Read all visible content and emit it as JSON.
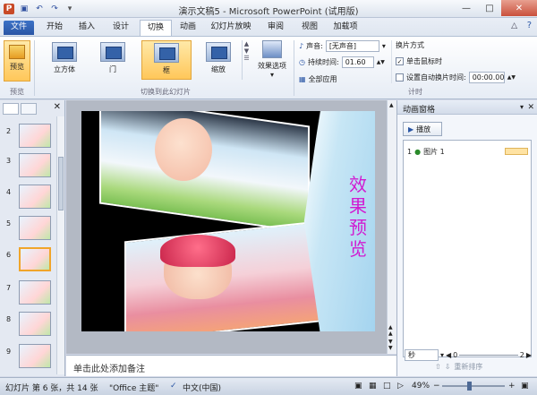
{
  "window": {
    "title": "演示文稿5 - Microsoft PowerPoint (试用版)",
    "buttons": [
      "minimize",
      "maximize",
      "close"
    ]
  },
  "quick_access": [
    "save-icon",
    "undo-icon",
    "redo-icon",
    "customize-icon"
  ],
  "tabs": [
    {
      "label": "文件",
      "active": false
    },
    {
      "label": "开始",
      "active": false
    },
    {
      "label": "插入",
      "active": false
    },
    {
      "label": "设计",
      "active": false
    },
    {
      "label": "切换",
      "active": true
    },
    {
      "label": "动画",
      "active": false
    },
    {
      "label": "幻灯片放映",
      "active": false
    },
    {
      "label": "审阅",
      "active": false
    },
    {
      "label": "视图",
      "active": false
    },
    {
      "label": "加载项",
      "active": false
    }
  ],
  "ribbon": {
    "preview_group": {
      "button": "预览",
      "label": "预览"
    },
    "transitions_group": {
      "items": [
        "立方体",
        "门",
        "框",
        "缩放"
      ],
      "selected": "框",
      "effect_options": "效果选项",
      "label": "切换到此幻灯片"
    },
    "timing_group": {
      "sound_label": "声音:",
      "sound_value": "[无声音]",
      "duration_label": "持续时间:",
      "duration_value": "01.60",
      "apply_all": "全部应用",
      "advance_title": "换片方式",
      "on_click_label": "单击鼠标时",
      "on_click_checked": true,
      "after_label": "设置自动换片时间:",
      "after_checked": false,
      "after_value": "00:00.00",
      "label": "计时"
    }
  },
  "thumbnails": [
    {
      "num": "2",
      "selected": false
    },
    {
      "num": "3",
      "selected": false
    },
    {
      "num": "4",
      "selected": false
    },
    {
      "num": "5",
      "selected": false
    },
    {
      "num": "6",
      "selected": true
    },
    {
      "num": "7",
      "selected": false
    },
    {
      "num": "8",
      "selected": false
    },
    {
      "num": "9",
      "selected": false
    }
  ],
  "slide": {
    "vertical_text": "效果预览"
  },
  "notes": {
    "placeholder": "单击此处添加备注"
  },
  "animation_pane": {
    "title": "动画窗格",
    "play_button": "播放",
    "items": [
      {
        "index": "1",
        "name": "图片 1"
      }
    ],
    "seconds_label": "秒",
    "timeline_start": "0",
    "timeline_end": "2",
    "reorder_label": "重新排序"
  },
  "status": {
    "slide_info": "幻灯片 第 6 张，共 14 张",
    "theme": "\"Office 主题\"",
    "language": "中文(中国)",
    "zoom": "49%"
  },
  "colors": {
    "accent": "#2a56a5",
    "selected": "#ffc75a",
    "vertical_text": "#d11ad1"
  }
}
